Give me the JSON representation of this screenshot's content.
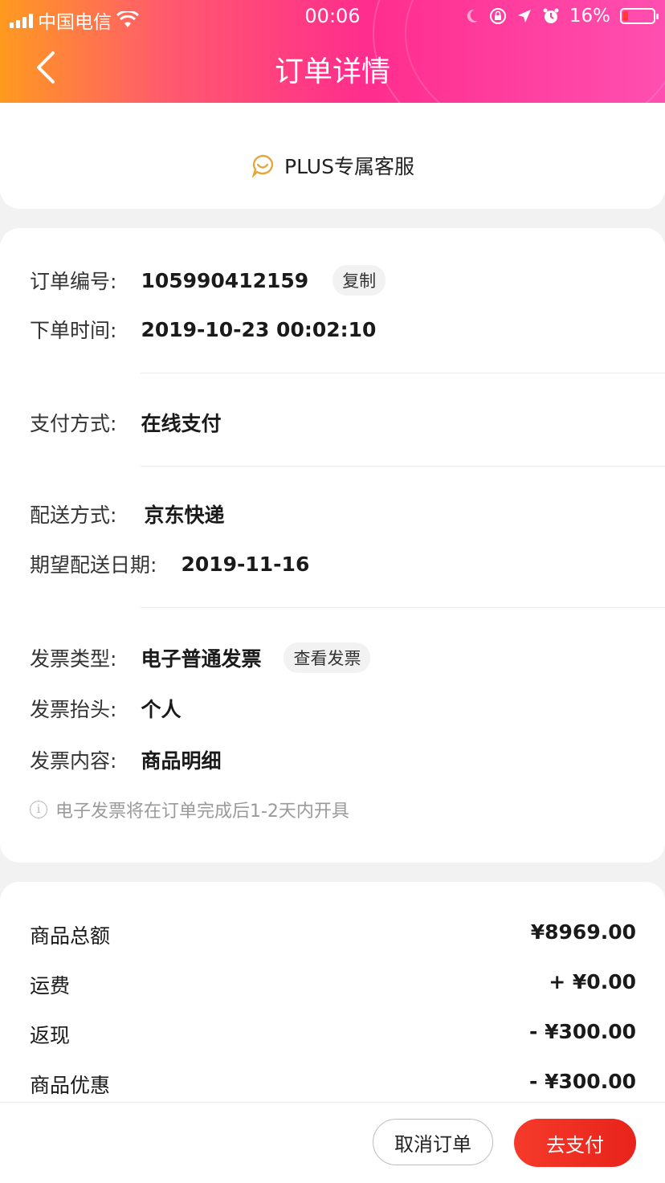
{
  "status_bar": {
    "carrier": "中国电信",
    "time": "00:06",
    "battery": "16%",
    "battery_level": 0.16,
    "icons": [
      "signal-icon",
      "wifi-icon",
      "moon-icon",
      "rotation-lock-icon",
      "location-icon",
      "alarm-icon",
      "battery-icon"
    ]
  },
  "nav": {
    "title": "订单详情",
    "back_icon": "chevron-left-icon"
  },
  "service": {
    "label": "PLUS专属客服",
    "icon": "chat-smile-icon",
    "icon_color": "#e3a73b"
  },
  "order_info": {
    "order_no_label": "订单编号:",
    "order_no": "105990412159",
    "copy_label": "复制",
    "order_time_label": "下单时间:",
    "order_time": "2019-10-23 00:02:10",
    "pay_method_label": "支付方式:",
    "pay_method": "在线支付",
    "delivery_label": "配送方式:",
    "delivery": "京东快递",
    "expected_date_label": "期望配送日期:",
    "expected_date": "2019-11-16",
    "invoice_type_label": "发票类型:",
    "invoice_type": "电子普通发票",
    "view_invoice_label": "查看发票",
    "invoice_title_label": "发票抬头:",
    "invoice_title": "个人",
    "invoice_content_label": "发票内容:",
    "invoice_content": "商品明细",
    "invoice_note": "电子发票将在订单完成后1-2天内开具"
  },
  "price": {
    "rows": [
      {
        "label": "商品总额",
        "amount": "¥8969.00"
      },
      {
        "label": "运费",
        "amount": "+ ¥0.00"
      },
      {
        "label": "返现",
        "amount": "- ¥300.00"
      },
      {
        "label": "商品优惠",
        "amount": "- ¥300.00"
      }
    ]
  },
  "actions": {
    "cancel": "取消订单",
    "pay": "去支付"
  },
  "colors": {
    "accent": "#f0301f",
    "header_start": "#ff9a1f",
    "header_end": "#ff2d8d"
  }
}
